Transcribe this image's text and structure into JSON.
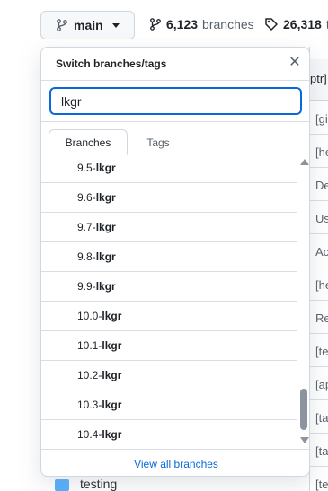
{
  "header": {
    "branch_button_label": "main",
    "branches_count": "6,123",
    "branches_label": "branches",
    "tags_count": "26,318",
    "tags_label": "t"
  },
  "background_list": {
    "header_text": "ptr]",
    "rows": [
      "[gi",
      "[he",
      "De",
      "Us",
      "Ac",
      "[he",
      "Re",
      "[te",
      "[ap",
      "[ta",
      "[ta",
      "[te"
    ],
    "bottom_folder_label": "testing"
  },
  "dropdown": {
    "title": "Switch branches/tags",
    "filter_value": "lkgr",
    "tabs": [
      "Branches",
      "Tags"
    ],
    "items": [
      {
        "prefix": "9.5-",
        "match": "lkgr"
      },
      {
        "prefix": "9.6-",
        "match": "lkgr"
      },
      {
        "prefix": "9.7-",
        "match": "lkgr"
      },
      {
        "prefix": "9.8-",
        "match": "lkgr"
      },
      {
        "prefix": "9.9-",
        "match": "lkgr"
      },
      {
        "prefix": "10.0-",
        "match": "lkgr"
      },
      {
        "prefix": "10.1-",
        "match": "lkgr"
      },
      {
        "prefix": "10.2-",
        "match": "lkgr"
      },
      {
        "prefix": "10.3-",
        "match": "lkgr"
      },
      {
        "prefix": "10.4-",
        "match": "lkgr"
      }
    ],
    "view_all_label": "View all branches"
  },
  "icons": {
    "branch": "git-branch-icon",
    "tag": "tag-icon",
    "close": "close-icon",
    "caret": "chevron-down-icon",
    "folder": "folder-icon"
  },
  "colors": {
    "accent": "#0969da",
    "border": "#d0d7de",
    "folder": "#54aeff"
  }
}
